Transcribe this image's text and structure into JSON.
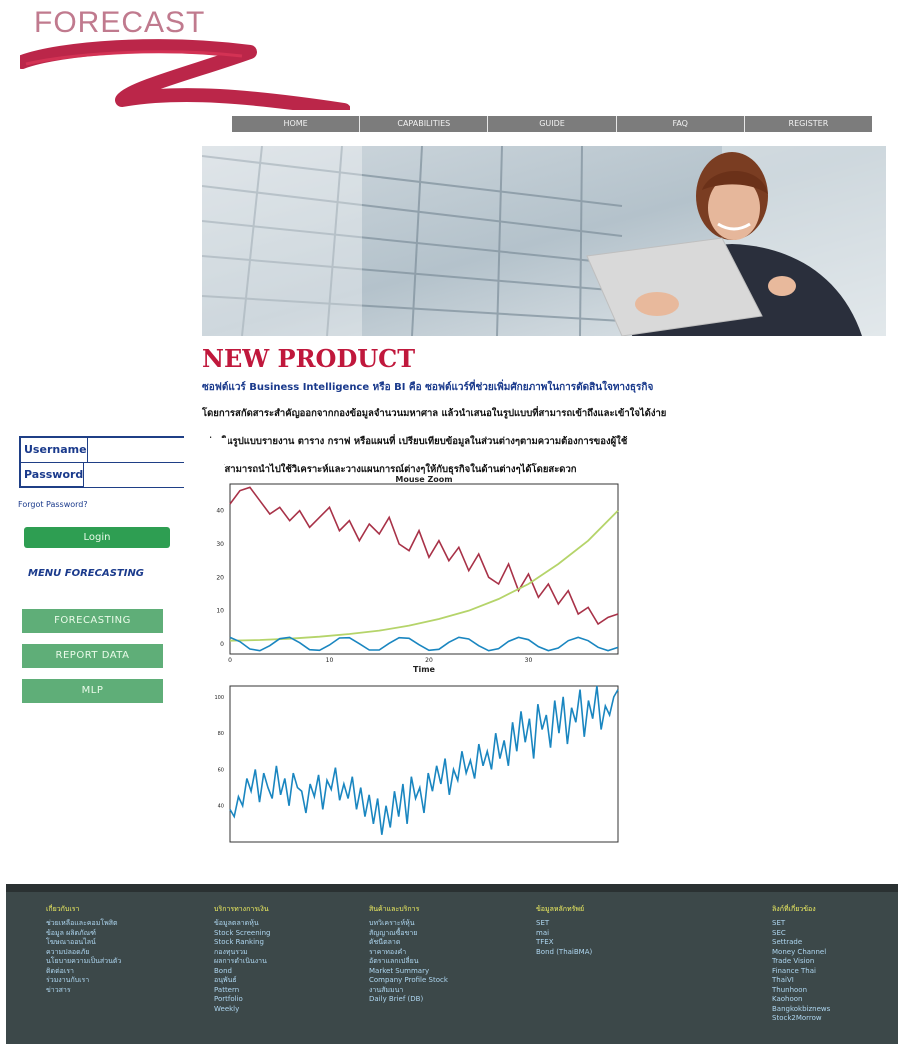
{
  "brand": {
    "name": "FORECAST",
    "accent": "#c0183c"
  },
  "nav": {
    "items": [
      "HOME",
      "CAPABILITIES",
      "GUIDE",
      "FAQ",
      "REGISTER"
    ]
  },
  "content": {
    "title": "NEW PRODUCT",
    "subtitle": "ซอฟต์แวร์ Business Intelligence หรือ BI คือ ซอฟต์แวร์ที่ช่วยเพิ่มศักยภาพในการตัดสินใจทางธุรกิจ",
    "lines": [
      "โดยการสกัดสาระสำคัญออกจากกองข้อมูลจำนวนมหาศาล แล้วนำเสนอในรูปแบบที่สามารถเข้าถึงและเข้าใจได้ง่าย",
      "เช่น ในรูปแบบรายงาน ตาราง กราฟ หรือแผนที่ เปรียบเทียบข้อมูลในส่วนต่างๆตามความต้องการของผู้ใช้",
      "ทำให้สามารถนำไปใช้วิเคราะห์และวางแผนการณ์ต่างๆให้กับธุรกิจในด้านต่างๆได้โดยสะดวก"
    ]
  },
  "login": {
    "username_label": "Username",
    "password_label": "Password",
    "forgot": "Forgot Password?",
    "button": "Login"
  },
  "menu": {
    "title": "MENU FORECASTING",
    "items": [
      "FORECASTING",
      "REPORT DATA",
      "MLP"
    ]
  },
  "chart_data": [
    {
      "type": "line",
      "title": "Mouse Zoom",
      "xlabel": "Time",
      "xlim": [
        0,
        39
      ],
      "ylim": [
        -3,
        48
      ],
      "xticks": [
        0,
        10,
        20,
        30
      ],
      "yticks": [
        0,
        10,
        20,
        30,
        40
      ],
      "series": [
        {
          "color": "#a83248",
          "x": [
            0,
            1,
            2,
            3,
            4,
            5,
            6,
            7,
            8,
            9,
            10,
            11,
            12,
            13,
            14,
            15,
            16,
            17,
            18,
            19,
            20,
            21,
            22,
            23,
            24,
            25,
            26,
            27,
            28,
            29,
            30,
            31,
            32,
            33,
            34,
            35,
            36,
            37,
            38,
            39
          ],
          "values": [
            42,
            46,
            47,
            43,
            39,
            41,
            37,
            40,
            35,
            38,
            41,
            34,
            37,
            31,
            36,
            33,
            38,
            30,
            28,
            34,
            26,
            31,
            25,
            29,
            22,
            27,
            20,
            18,
            24,
            16,
            21,
            14,
            18,
            12,
            16,
            9,
            11,
            6,
            8,
            9
          ]
        },
        {
          "color": "#b5d46a",
          "x": [
            0,
            3,
            6,
            9,
            12,
            15,
            18,
            21,
            24,
            27,
            30,
            33,
            36,
            39
          ],
          "values": [
            1,
            1.2,
            1.6,
            2.2,
            3,
            4,
            5.5,
            7.5,
            10,
            13.5,
            18,
            24,
            31,
            40
          ]
        },
        {
          "color": "#1a86c0",
          "x": [
            0,
            1,
            2,
            3,
            4,
            5,
            6,
            7,
            8,
            9,
            10,
            11,
            12,
            13,
            14,
            15,
            16,
            17,
            18,
            19,
            20,
            21,
            22,
            23,
            24,
            25,
            26,
            27,
            28,
            29,
            30,
            31,
            32,
            33,
            34,
            35,
            36,
            37,
            38,
            39
          ],
          "values": [
            2,
            0.7,
            -1.5,
            -2,
            -0.5,
            1.6,
            2,
            0.4,
            -1.7,
            -1.9,
            -0.3,
            1.8,
            1.9,
            0.1,
            -1.8,
            -1.8,
            0.2,
            1.9,
            1.7,
            -0.2,
            -1.9,
            -1.6,
            0.5,
            2,
            1.5,
            -0.5,
            -2,
            -1.4,
            0.8,
            2,
            1.3,
            -0.8,
            -2,
            -1.2,
            1,
            2,
            1,
            -1,
            -2,
            -1
          ]
        }
      ]
    },
    {
      "type": "line",
      "ylim": [
        20,
        106
      ],
      "yticks": [
        40,
        60,
        80,
        100
      ],
      "series": [
        {
          "color": "#1a86c0",
          "values": [
            38,
            34,
            45,
            40,
            55,
            48,
            60,
            42,
            58,
            50,
            44,
            62,
            46,
            55,
            40,
            58,
            50,
            48,
            36,
            52,
            45,
            57,
            38,
            54,
            49,
            61,
            43,
            52,
            44,
            56,
            38,
            50,
            34,
            46,
            30,
            44,
            24,
            40,
            28,
            48,
            34,
            52,
            30,
            56,
            44,
            50,
            36,
            58,
            48,
            62,
            52,
            66,
            46,
            60,
            54,
            70,
            58,
            65,
            55,
            74,
            62,
            70,
            60,
            80,
            66,
            76,
            62,
            86,
            70,
            92,
            75,
            88,
            66,
            96,
            82,
            90,
            72,
            98,
            80,
            100,
            74,
            94,
            86,
            104,
            78,
            98,
            88,
            106,
            82,
            95,
            90,
            100,
            104
          ]
        }
      ]
    }
  ],
  "footer": {
    "columns": [
      {
        "head": "เกี่ยวกับเรา",
        "items": [
          "ช่วยเหลือและคอมโพสิต",
          "ข้อมูล ผลิตภัณฑ์",
          "โฆษณาออนไลน์",
          "ความปลอดภัย",
          "นโยบายความเป็นส่วนตัว",
          "ติดต่อเรา",
          "ร่วมงานกับเรา",
          "ข่าวสาร"
        ]
      },
      {
        "head": "บริการทางการเงิน",
        "items": [
          "ข้อมูลตลาดหุ้น",
          "Stock Screening",
          "Stock Ranking",
          "กองทุนรวม",
          "ผลการดำเนินงาน",
          "Bond",
          "อนุพันธ์",
          "Pattern",
          "Portfolio",
          "Weekly"
        ]
      },
      {
        "head": "สินค้าและบริการ",
        "items": [
          "บทวิเคราะห์หุ้น",
          "สัญญาณซื้อขาย",
          "ดัชนีตลาด",
          "ราคาทองคำ",
          "อัตราแลกเปลี่ยน",
          "Market Summary",
          "Company Profile Stock",
          "งานสัมมนา",
          "Daily Brief (DB)"
        ]
      },
      {
        "head": "ข้อมูลหลักทรัพย์",
        "items": [
          "SET",
          "mai",
          "TFEX",
          "Bond (ThaiBMA)"
        ]
      },
      {
        "head": "ลิงก์ที่เกี่ยวข้อง",
        "items": [
          "SET",
          "SEC",
          "Settrade",
          "Money Channel",
          "Trade Vision",
          "Finance Thai",
          "ThaiVI",
          "Thunhoon",
          "Kaohoon",
          "Bangkokbiznews",
          "Stock2Morrow"
        ]
      }
    ]
  }
}
